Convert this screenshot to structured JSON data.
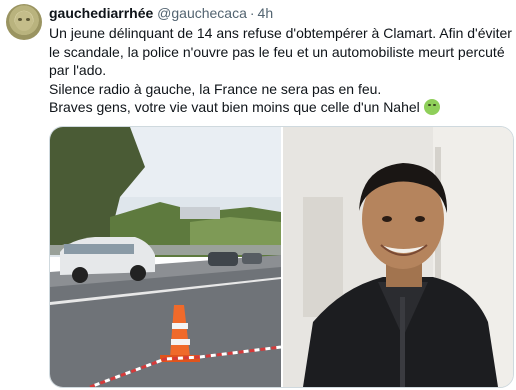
{
  "tweet": {
    "author_name": "gauchediarrhée",
    "handle": "@gauchecaca",
    "separator": "·",
    "time": "4h",
    "lines": [
      "Un jeune délinquant de 14 ans refuse d'obtempérer à Clamart. Afin d'éviter le scandale, la police  n'ouvre pas le feu et un automobiliste meurt percuté par l'ado.",
      "Silence radio à gauche, la France ne sera pas en feu.",
      "Braves gens, votre vie vaut bien moins que celle d'un Nahel"
    ],
    "emoji": "nauseated-face-emoji"
  },
  "media": {
    "images": [
      {
        "name": "road-scene-photo",
        "description_icon": "photo"
      },
      {
        "name": "portrait-photo",
        "description_icon": "photo"
      }
    ]
  }
}
